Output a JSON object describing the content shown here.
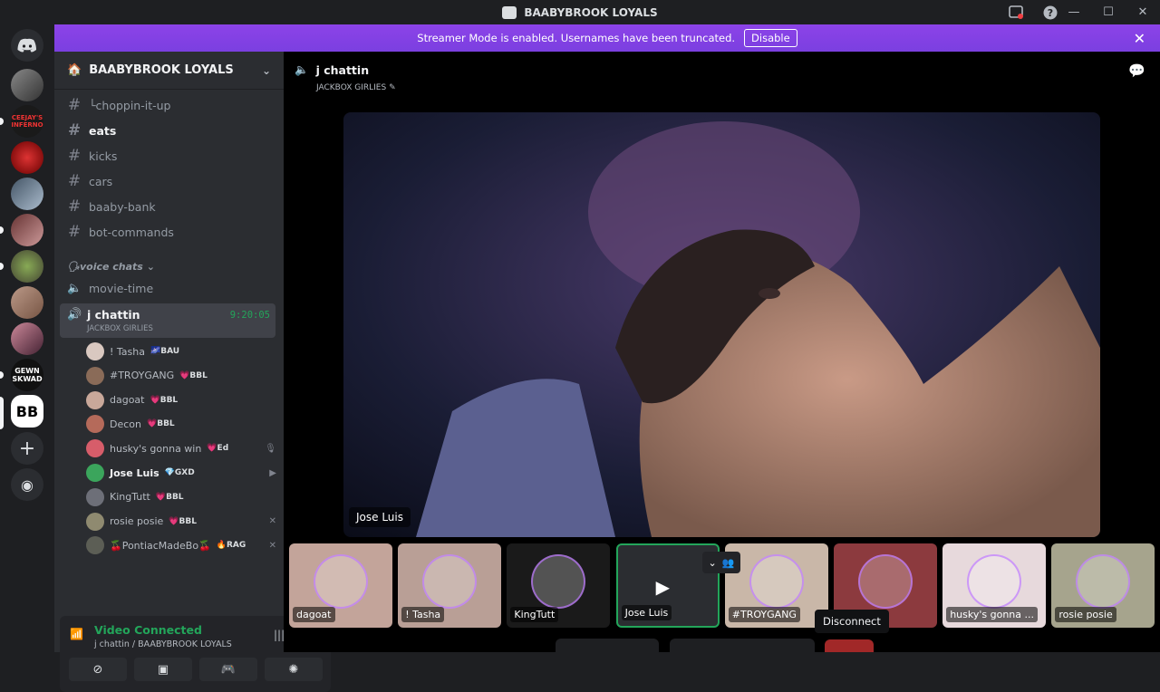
{
  "window": {
    "title": "BAABYBROOK LOYALS"
  },
  "banner": {
    "message": "Streamer Mode is enabled. Usernames have been truncated.",
    "button": "Disable"
  },
  "server": {
    "name": "BAABYBROOK LOYALS"
  },
  "channels": [
    {
      "name": "└choppin-it-up",
      "active": false
    },
    {
      "name": "eats",
      "active": true
    },
    {
      "name": "kicks",
      "active": false
    },
    {
      "name": "cars",
      "active": false
    },
    {
      "name": "baaby-bank",
      "active": false
    },
    {
      "name": "bot-commands",
      "active": false
    }
  ],
  "voice_category": "🗣voice chats",
  "voice_channels": [
    {
      "name": "movie-time"
    },
    {
      "name": "j chattin",
      "subtitle": "JACKBOX GIRLIES",
      "timer": "9:20:05"
    }
  ],
  "members": [
    {
      "name": "! Tasha",
      "tag": "🌌BAU",
      "color": "#d9c8c0"
    },
    {
      "name": "#TROYGANG",
      "tag": "💗BBL",
      "color": "#8a6b58"
    },
    {
      "name": "dagoat",
      "tag": "💗BBL",
      "color": "#c9a89a"
    },
    {
      "name": "Decon",
      "tag": "💗BBL",
      "color": "#b56a5a"
    },
    {
      "name": "husky's gonna win",
      "tag": "💗Ed",
      "color": "#d75d6a",
      "icon": "🎙"
    },
    {
      "name": "Jose Luis",
      "tag": "💎GXD",
      "color": "#3ba55c",
      "icon": "▶",
      "bold": true
    },
    {
      "name": "KingTutt",
      "tag": "💗BBL",
      "color": "#6d6f78"
    },
    {
      "name": "rosie posie",
      "tag": "💗BBL",
      "color": "#8f8a70",
      "icon": "✕"
    },
    {
      "name": "🍒PontiacMadeBo🍒",
      "tag": "🔥RAG",
      "color": "#5c5e55",
      "icon": "✕"
    }
  ],
  "connection": {
    "status": "Video Connected",
    "location": "j chattin / BAABYBROOK LOYALS"
  },
  "voice_view": {
    "channel": "j chattin",
    "subtitle": "JACKBOX GIRLIES",
    "speaker": "Jose Luis"
  },
  "tiles": [
    {
      "name": "dagoat",
      "bg": "#c3a49a"
    },
    {
      "name": "! Tasha",
      "bg": "#b99f96"
    },
    {
      "name": "KingTutt",
      "bg": "#1a1a1a"
    },
    {
      "name": "Jose Luis",
      "bg": "#2b2d31"
    },
    {
      "name": "#TROYGANG",
      "bg": "#c9b7a8"
    },
    {
      "name": "",
      "bg": "#8c3a3e"
    },
    {
      "name": "husky's gonna ...",
      "bg": "#e7d9dc"
    },
    {
      "name": "rosie posie",
      "bg": "#a6a48d"
    }
  ],
  "tooltip": "Disconnect"
}
